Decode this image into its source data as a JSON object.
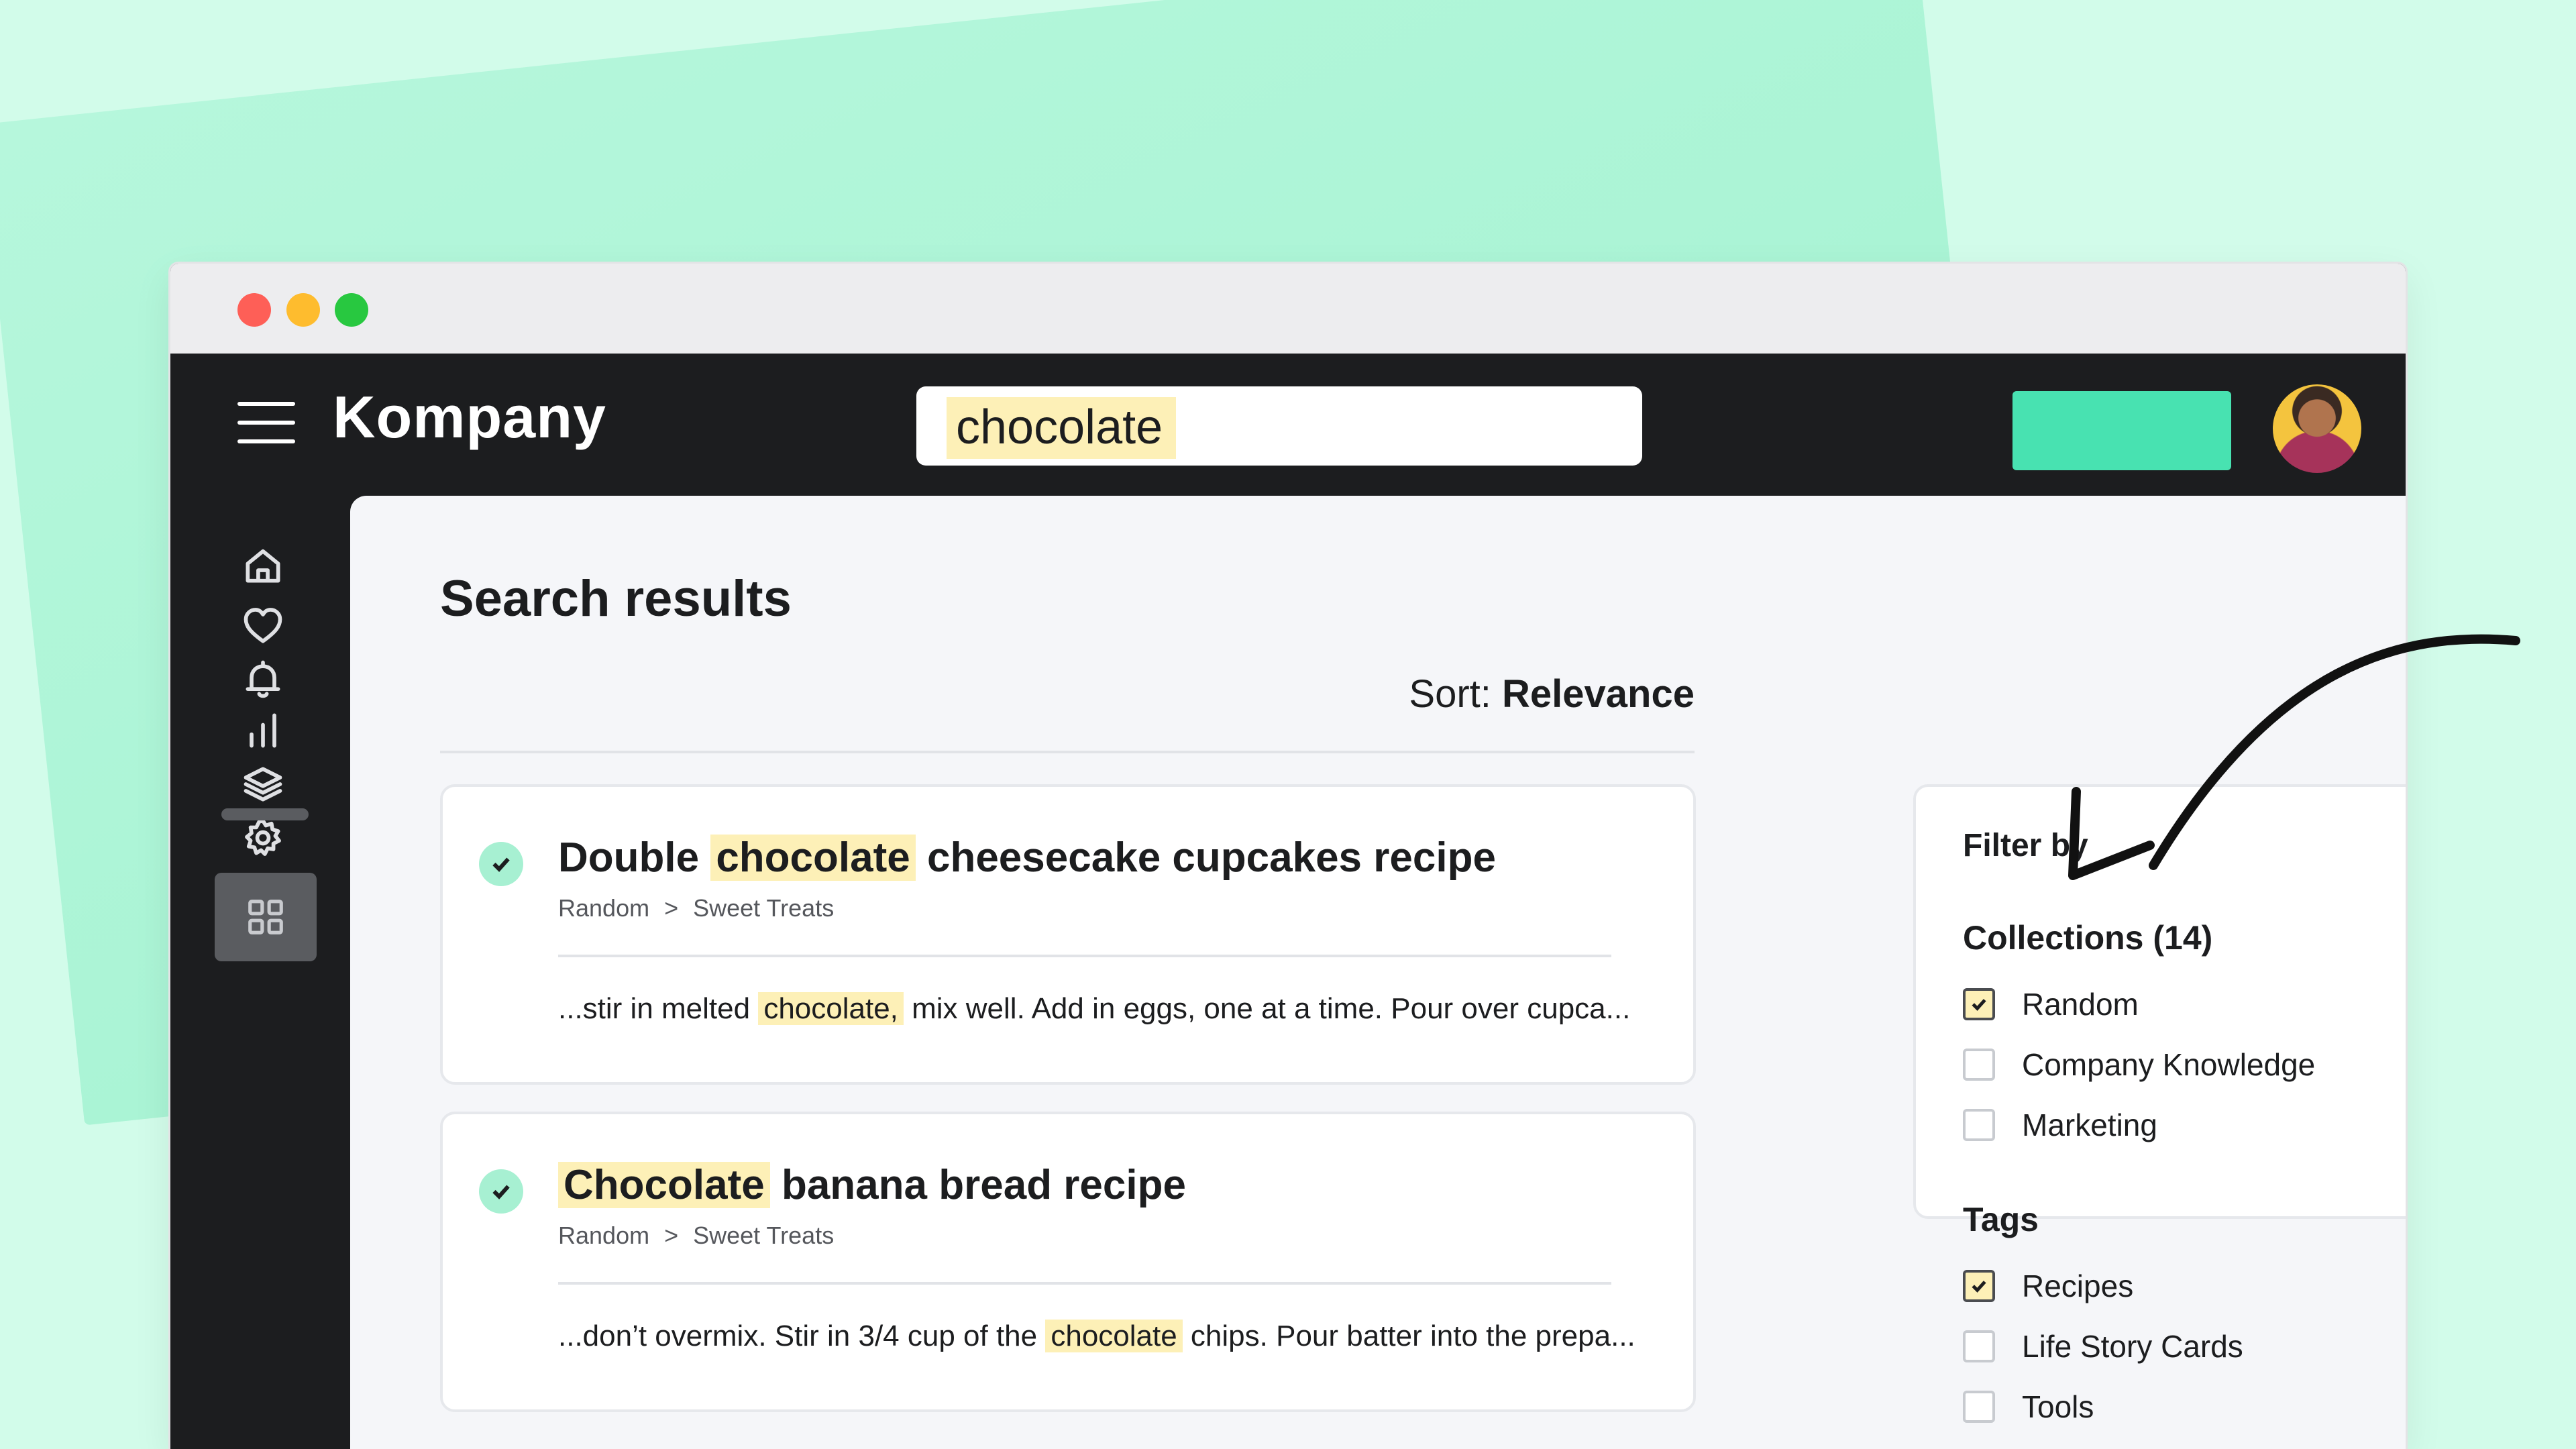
{
  "app": {
    "brand": "Kompany"
  },
  "search": {
    "query": "chocolate"
  },
  "page": {
    "title": "Search results",
    "sort_label": "Sort:",
    "sort_value": "Relevance"
  },
  "sidebar": {
    "icons": [
      "home-icon",
      "heart-icon",
      "bell-icon",
      "bar-chart-icon",
      "layers-icon",
      "gear-icon",
      "grid-icon"
    ]
  },
  "results": [
    {
      "title_pre": "Double ",
      "title_hl": "chocolate",
      "title_post": " cheesecake cupcakes recipe",
      "crumb_1": "Random",
      "crumb_sep": ">",
      "crumb_2": "Sweet Treats",
      "snippet_pre": "...stir in melted ",
      "snippet_hl": "chocolate,",
      "snippet_post": " mix well. Add in eggs, one at a time. Pour over cupca..."
    },
    {
      "title_pre": "",
      "title_hl": "Chocolate",
      "title_post": " banana bread recipe",
      "crumb_1": "Random",
      "crumb_sep": ">",
      "crumb_2": "Sweet Treats",
      "snippet_pre": "...don’t overmix. Stir in 3/4 cup of the ",
      "snippet_hl": "chocolate",
      "snippet_post": " chips. Pour batter into the prepa..."
    }
  ],
  "filter": {
    "title": "Filter by",
    "collections_title": "Collections (14)",
    "collections": [
      {
        "label": "Random",
        "checked": true
      },
      {
        "label": "Company Knowledge",
        "checked": false
      },
      {
        "label": "Marketing",
        "checked": false
      }
    ],
    "tags_title": "Tags",
    "tags": [
      {
        "label": "Recipes",
        "checked": true
      },
      {
        "label": "Life Story Cards",
        "checked": false
      },
      {
        "label": "Tools",
        "checked": false
      }
    ]
  },
  "colors": {
    "background": "#d2fcea",
    "accent": "#48e2b1",
    "highlight": "#fdf0b7",
    "dark": "#1c1d1f"
  }
}
